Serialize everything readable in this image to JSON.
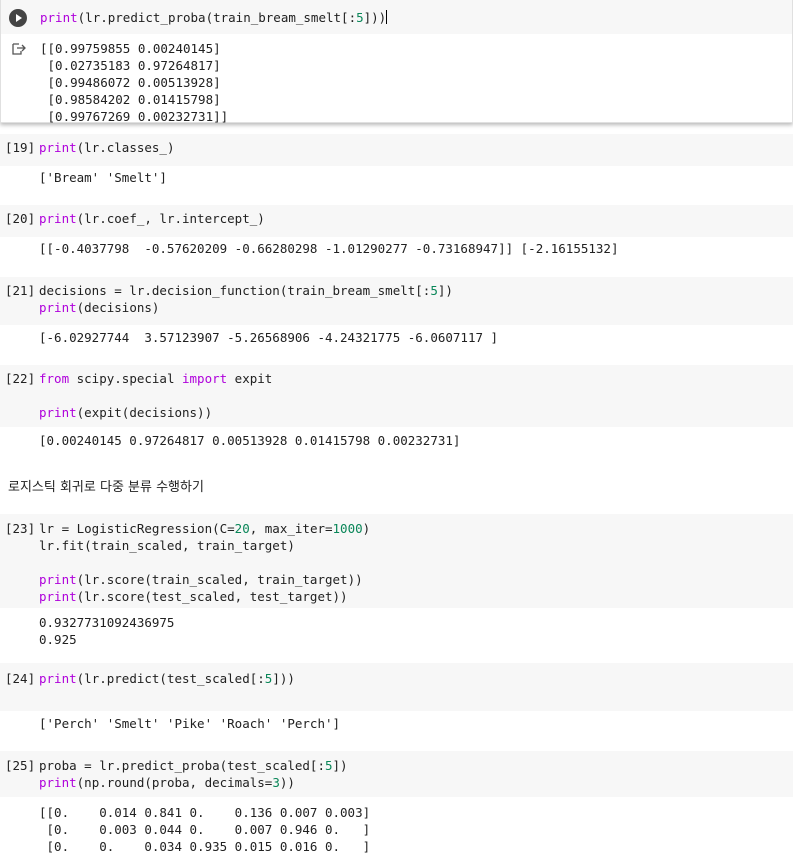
{
  "cells": {
    "c18": {
      "code_line1": "print(lr.predict_proba(train_bream_smelt[:5]))",
      "output": [
        "[[0.99759855 0.00240145]",
        " [0.02735183 0.97264817]",
        " [0.99486072 0.00513928]",
        " [0.98584202 0.01415798]",
        " [0.99767269 0.00232731]]"
      ]
    },
    "c19": {
      "exec": "[19]",
      "code": "print(lr.classes_)",
      "output": "['Bream' 'Smelt']"
    },
    "c20": {
      "exec": "[20]",
      "code": "print(lr.coef_, lr.intercept_)",
      "output": "[[-0.4037798  -0.57620209 -0.66280298 -1.01290277 -0.73168947]] [-2.16155132]"
    },
    "c21": {
      "exec": "[21]",
      "code_line1": "decisions = lr.decision_function(train_bream_smelt[:5])",
      "code_line2": "print(decisions)",
      "output": "[-6.02927744  3.57123907 -5.26568906 -4.24321775 -6.0607117 ]"
    },
    "c22": {
      "exec": "[22]",
      "code_line1": "from scipy.special import expit",
      "code_line2": "print(expit(decisions))",
      "output": "[0.00240145 0.97264817 0.00513928 0.01415798 0.00232731]"
    },
    "text": "로지스틱 회귀로 다중 분류 수행하기",
    "c23": {
      "exec": "[23]",
      "code_line1": "lr = LogisticRegression(C=20, max_iter=1000)",
      "code_line2": "lr.fit(train_scaled, train_target)",
      "code_line3": "print(lr.score(train_scaled, train_target))",
      "code_line4": "print(lr.score(test_scaled, test_target))",
      "output": [
        "0.9327731092436975",
        "0.925"
      ]
    },
    "c24": {
      "exec": "[24]",
      "code": "print(lr.predict(test_scaled[:5]))",
      "output": "['Perch' 'Smelt' 'Pike' 'Roach' 'Perch']"
    },
    "c25": {
      "exec": "[25]",
      "code_line1": "proba = lr.predict_proba(test_scaled[:5])",
      "code_line2": "print(np.round(proba, decimals=3))",
      "output": [
        "[[0.    0.014 0.841 0.    0.136 0.007 0.003]",
        " [0.    0.003 0.044 0.    0.007 0.946 0.   ]",
        " [0.    0.    0.034 0.935 0.015 0.016 0.   ]"
      ]
    }
  }
}
